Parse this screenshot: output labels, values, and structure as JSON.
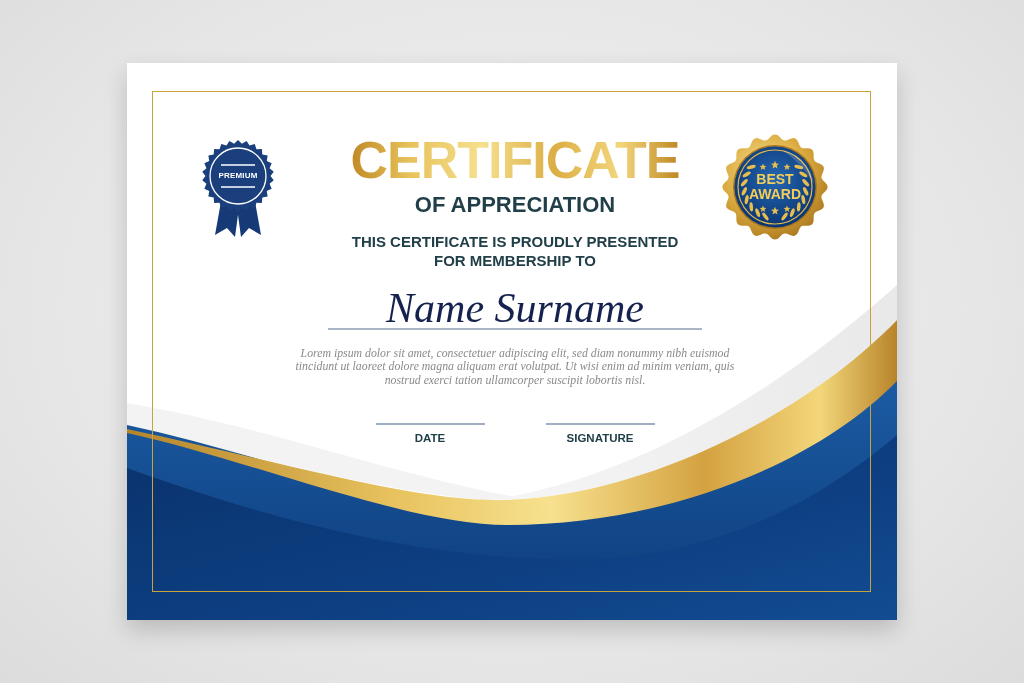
{
  "certificate": {
    "seals": [
      {
        "kind": "rosette",
        "label": "PREMIUM"
      },
      {
        "kind": "medal",
        "label": "BEST AWARD"
      }
    ],
    "title": "CERTIFICATE",
    "subtitle": "OF APPRECIATION",
    "presentation": "THIS CERTIFICATE IS PROUDLY PRESENTED FOR MEMBERSHIP TO",
    "recipient_name": "Name Surname",
    "body": "Lorem ipsum dolor sit amet, consectetuer adipiscing elit, sed diam nonummy nibh euismod tincidunt ut laoreet dolore magna aliquam erat volutpat. Ut wisi enim ad minim veniam, quis nostrud exerci tation ullamcorper suscipit lobortis nisl.",
    "sign_fields": [
      {
        "label": "DATE"
      },
      {
        "label": "SIGNATURE"
      }
    ]
  }
}
